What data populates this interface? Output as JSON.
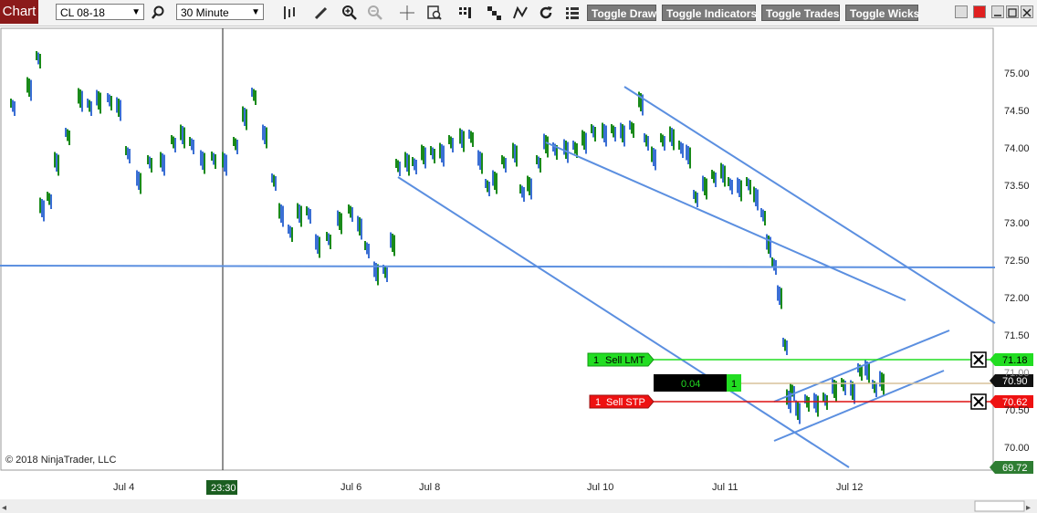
{
  "toolbar": {
    "chart_tab": "Chart",
    "instrument": "CL 08-18",
    "interval": "30 Minute",
    "buttons": [
      "Toggle Draw",
      "Toggle Indicators",
      "Toggle Trades",
      "Toggle Wicks"
    ]
  },
  "y_axis_ticks": [
    "75.00",
    "74.50",
    "74.00",
    "73.50",
    "73.00",
    "72.50",
    "72.00",
    "71.50",
    "71.00",
    "70.50",
    "70.00"
  ],
  "x_axis_ticks": [
    "Jul 4",
    "Jul 6",
    "Jul 8",
    "Jul 10",
    "Jul 11",
    "Jul 12"
  ],
  "crosshair_time": "23:30",
  "copyright": "© 2018 NinjaTrader, LLC",
  "orders": {
    "sell_limit": {
      "qty": "1",
      "label": "Sell LMT",
      "price": "71.18"
    },
    "sell_stop": {
      "qty": "1",
      "label": "Sell STP",
      "price": "70.62"
    },
    "position": {
      "pnl": "0.04",
      "qty": "1",
      "price": "70.90"
    }
  },
  "last_price": "69.72",
  "colors": {
    "up_bar": "#1a8a1a",
    "down_bar": "#3b6fd4",
    "trendline": "#5b8fe0",
    "sell_limit": "#22dd22",
    "sell_stop": "#dd1111",
    "position_line": "#d8c29a",
    "last_price": "#2e7d32"
  },
  "icons": [
    "search-icon",
    "bar-type-icon",
    "pencil-icon",
    "zoom-in-icon",
    "zoom-out-icon",
    "crosshair-icon",
    "data-box-icon",
    "properties-icon",
    "strategy-icon",
    "drawing-icon",
    "refresh-icon",
    "menu-icon"
  ]
}
